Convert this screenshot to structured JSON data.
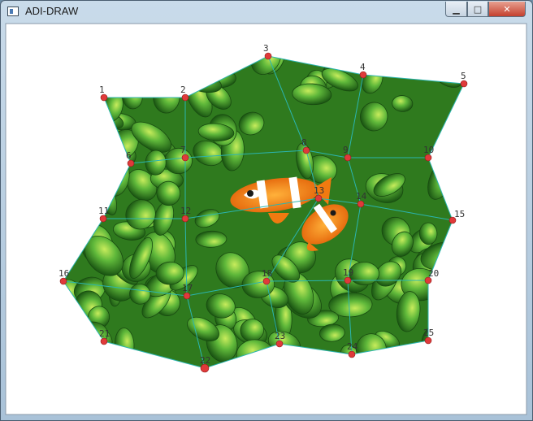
{
  "window": {
    "title": "ADI-DRAW",
    "minimize_glyph": "▁",
    "maximize_glyph": "□",
    "close_glyph": "✕"
  },
  "points": [
    {
      "label": "1"
    },
    {
      "label": "2"
    },
    {
      "label": "3"
    },
    {
      "label": "4"
    },
    {
      "label": "5"
    },
    {
      "label": "6"
    },
    {
      "label": "7"
    },
    {
      "label": "8"
    },
    {
      "label": "9"
    },
    {
      "label": "10"
    },
    {
      "label": "11"
    },
    {
      "label": "12"
    },
    {
      "label": "13"
    },
    {
      "label": "14"
    },
    {
      "label": "15"
    },
    {
      "label": "16"
    },
    {
      "label": "17"
    },
    {
      "label": "18"
    },
    {
      "label": "19"
    },
    {
      "label": "20"
    },
    {
      "label": "21"
    },
    {
      "label": "22"
    },
    {
      "label": "23"
    },
    {
      "label": "24"
    },
    {
      "label": "25"
    }
  ],
  "colors": {
    "mesh_edge": "#2bb5b0",
    "point_fill": "#e03a3a",
    "client_bg": "#ffffff"
  }
}
